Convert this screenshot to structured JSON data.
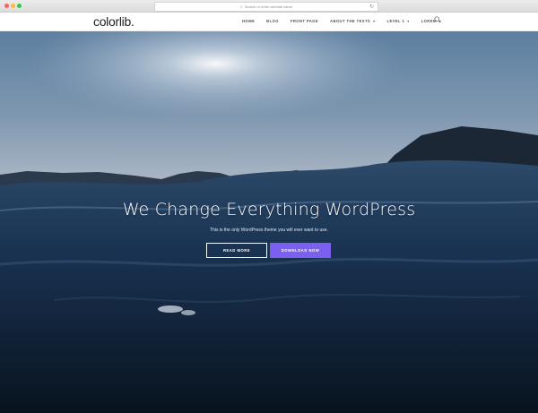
{
  "browser": {
    "url_placeholder": "Search or enter website name",
    "reload_icon": "↻"
  },
  "header": {
    "logo": "colorlib.",
    "nav": [
      {
        "label": "HOME",
        "has_caret": false
      },
      {
        "label": "BLOG",
        "has_caret": false
      },
      {
        "label": "FRONT PAGE",
        "has_caret": false
      },
      {
        "label": "ABOUT THE TESTS",
        "has_caret": true
      },
      {
        "label": "LEVEL 1",
        "has_caret": true
      },
      {
        "label": "LOREM",
        "has_caret": true
      }
    ],
    "caret_glyph": "▾"
  },
  "hero": {
    "title": "We Change Everything WordPress",
    "subtitle": "This is the only WordPress theme you will ever want to use.",
    "buttons": {
      "read_more": "READ MORE",
      "download_now": "DOWNLOAD NOW"
    }
  },
  "colors": {
    "accent": "#7a5ff0",
    "header_bg": "#ffffff",
    "text_dark": "#222222"
  }
}
